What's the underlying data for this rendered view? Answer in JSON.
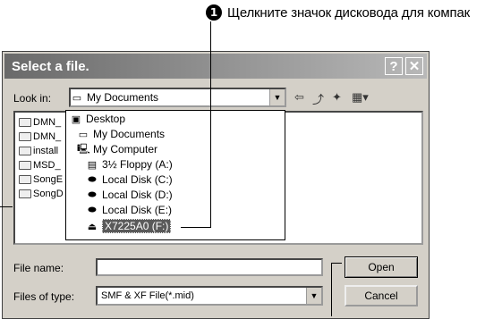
{
  "annotation": {
    "number": "1",
    "text": "Щелкните значок дисковода для компак"
  },
  "dialog": {
    "title": "Select a file.",
    "help_glyph": "?",
    "close_glyph": "✕",
    "look_in_label": "Look in:",
    "look_in_value": "My Documents",
    "file_name_label": "File name:",
    "file_name_value": "",
    "files_of_type_label": "Files of type:",
    "files_of_type_value": "SMF & XF File(*.mid)",
    "open_label": "Open",
    "cancel_label": "Cancel",
    "files": [
      "DMN_",
      "DMN_",
      "install",
      "MSD_",
      "SongE",
      "SongD"
    ],
    "dropdown": [
      {
        "label": "Desktop",
        "icon": "desktop-icon"
      },
      {
        "label": "My Documents",
        "icon": "my-documents-icon"
      },
      {
        "label": "My Computer",
        "icon": "my-computer-icon"
      },
      {
        "label": "3½ Floppy (A:)",
        "icon": "floppy-icon"
      },
      {
        "label": "Local Disk (C:)",
        "icon": "disk-icon"
      },
      {
        "label": "Local Disk (D:)",
        "icon": "disk-icon"
      },
      {
        "label": "Local Disk (E:)",
        "icon": "disk-icon"
      },
      {
        "label": "X7225A0 (F:)",
        "icon": "usb-drive-icon",
        "selected": true
      }
    ]
  }
}
